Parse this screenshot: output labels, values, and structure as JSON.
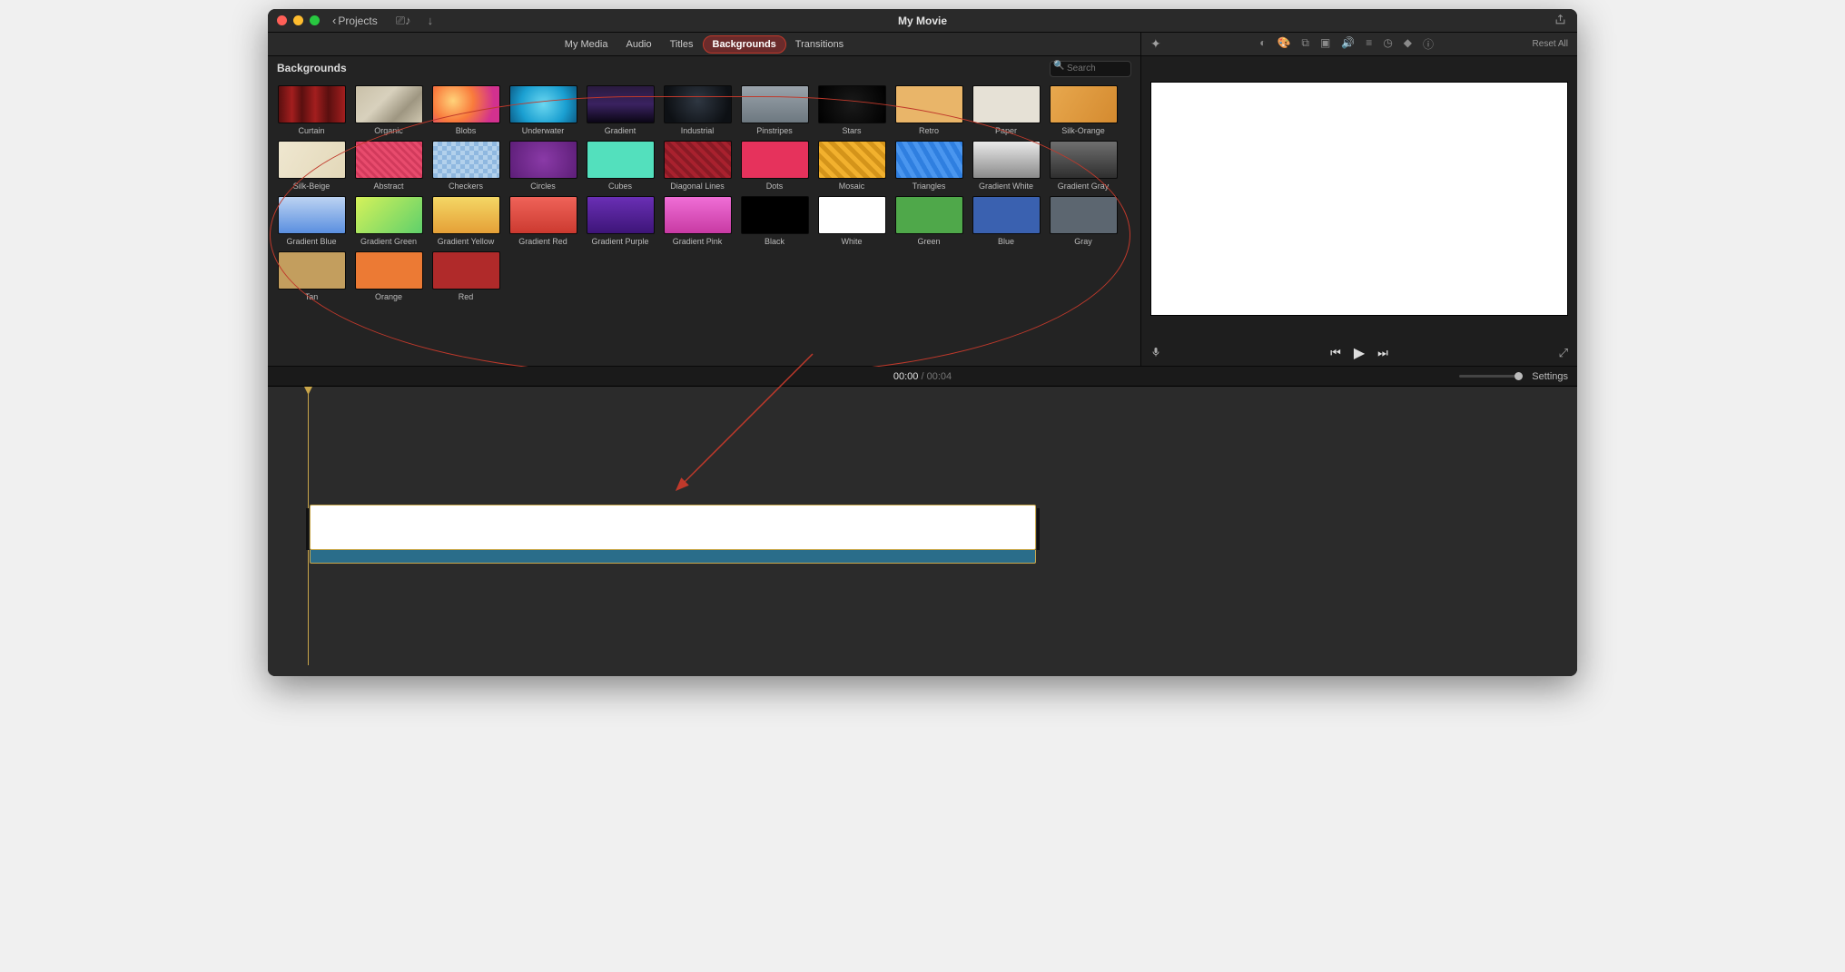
{
  "titlebar": {
    "projects_label": "Projects",
    "movie_title": "My Movie"
  },
  "tabs": [
    {
      "id": "my-media",
      "label": "My Media"
    },
    {
      "id": "audio",
      "label": "Audio"
    },
    {
      "id": "titles",
      "label": "Titles"
    },
    {
      "id": "backgrounds",
      "label": "Backgrounds",
      "active": true
    },
    {
      "id": "transitions",
      "label": "Transitions"
    }
  ],
  "panel": {
    "title": "Backgrounds",
    "search_placeholder": "Search"
  },
  "backgrounds": [
    {
      "id": "curtain",
      "label": "Curtain",
      "css": "bg-curtain"
    },
    {
      "id": "organic",
      "label": "Organic",
      "css": "bg-organic"
    },
    {
      "id": "blobs",
      "label": "Blobs",
      "css": "bg-blobs"
    },
    {
      "id": "underwater",
      "label": "Underwater",
      "css": "bg-underwater"
    },
    {
      "id": "gradient",
      "label": "Gradient",
      "css": "bg-gradient"
    },
    {
      "id": "industrial",
      "label": "Industrial",
      "css": "bg-industrial"
    },
    {
      "id": "pinstripes",
      "label": "Pinstripes",
      "css": "bg-pinstripes"
    },
    {
      "id": "stars",
      "label": "Stars",
      "css": "bg-stars"
    },
    {
      "id": "retro",
      "label": "Retro",
      "css": "bg-retro"
    },
    {
      "id": "paper",
      "label": "Paper",
      "css": "bg-paper"
    },
    {
      "id": "silk-orange",
      "label": "Silk-Orange",
      "css": "bg-silk-orange"
    },
    {
      "id": "silk-beige",
      "label": "Silk-Beige",
      "css": "bg-silk-beige"
    },
    {
      "id": "abstract",
      "label": "Abstract",
      "css": "bg-abstract"
    },
    {
      "id": "checkers",
      "label": "Checkers",
      "css": "bg-checkers"
    },
    {
      "id": "circles",
      "label": "Circles",
      "css": "bg-circles"
    },
    {
      "id": "cubes",
      "label": "Cubes",
      "css": "bg-cubes"
    },
    {
      "id": "diagonal-lines",
      "label": "Diagonal Lines",
      "css": "bg-diagonal"
    },
    {
      "id": "dots",
      "label": "Dots",
      "css": "bg-dots"
    },
    {
      "id": "mosaic",
      "label": "Mosaic",
      "css": "bg-mosaic"
    },
    {
      "id": "triangles",
      "label": "Triangles",
      "css": "bg-triangles"
    },
    {
      "id": "gradient-white",
      "label": "Gradient White",
      "css": "bg-grad-white"
    },
    {
      "id": "gradient-gray",
      "label": "Gradient Gray",
      "css": "bg-grad-gray"
    },
    {
      "id": "gradient-blue",
      "label": "Gradient Blue",
      "css": "bg-grad-blue"
    },
    {
      "id": "gradient-green",
      "label": "Gradient Green",
      "css": "bg-grad-green"
    },
    {
      "id": "gradient-yellow",
      "label": "Gradient Yellow",
      "css": "bg-grad-yellow"
    },
    {
      "id": "gradient-red",
      "label": "Gradient Red",
      "css": "bg-grad-red"
    },
    {
      "id": "gradient-purple",
      "label": "Gradient Purple",
      "css": "bg-grad-purple"
    },
    {
      "id": "gradient-pink",
      "label": "Gradient Pink",
      "css": "bg-grad-pink"
    },
    {
      "id": "black",
      "label": "Black",
      "css": "bg-black"
    },
    {
      "id": "white",
      "label": "White",
      "css": "bg-white"
    },
    {
      "id": "green",
      "label": "Green",
      "css": "bg-green"
    },
    {
      "id": "blue",
      "label": "Blue",
      "css": "bg-blue"
    },
    {
      "id": "gray",
      "label": "Gray",
      "css": "bg-gray"
    },
    {
      "id": "tan",
      "label": "Tan",
      "css": "bg-tan"
    },
    {
      "id": "orange",
      "label": "Orange",
      "css": "bg-orange"
    },
    {
      "id": "red",
      "label": "Red",
      "css": "bg-red"
    }
  ],
  "viewer": {
    "reset_label": "Reset All"
  },
  "timebar": {
    "current": "00:00",
    "total": "00:04",
    "settings_label": "Settings"
  }
}
